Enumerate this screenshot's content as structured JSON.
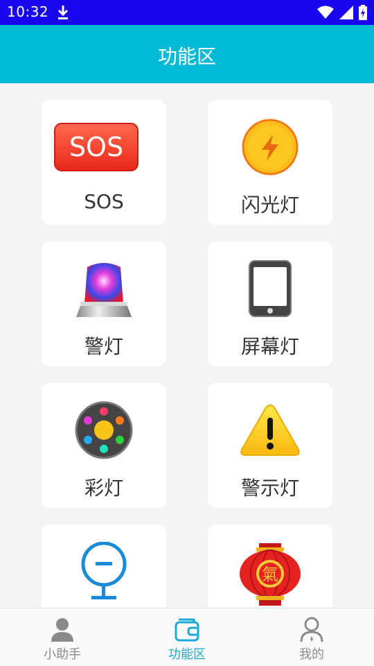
{
  "status_bar": {
    "time": "10:32"
  },
  "app_bar": {
    "title": "功能区"
  },
  "cards": [
    {
      "label": "SOS",
      "icon": "sos-badge-icon",
      "icon_text": "SOS"
    },
    {
      "label": "闪光灯",
      "icon": "lightning-bolt-icon"
    },
    {
      "label": "警灯",
      "icon": "siren-icon"
    },
    {
      "label": "屏幕灯",
      "icon": "phone-screen-icon"
    },
    {
      "label": "彩灯",
      "icon": "color-light-icon"
    },
    {
      "label": "警示灯",
      "icon": "warning-triangle-icon"
    },
    {
      "label": "",
      "icon": "magnifier-lamp-icon"
    },
    {
      "label": "",
      "icon": "lantern-icon",
      "icon_text": "氣"
    }
  ],
  "bottom_nav": {
    "items": [
      {
        "label": "小助手",
        "icon": "person-icon",
        "active": false
      },
      {
        "label": "功能区",
        "icon": "wallet-icon",
        "active": true
      },
      {
        "label": "我的",
        "icon": "profile-icon",
        "active": false
      }
    ]
  },
  "colors": {
    "status_bar": "#1a06ee",
    "app_bar": "#02bad6",
    "active_tab": "#1aa9d5",
    "inactive_tab": "#8a8a8a"
  }
}
